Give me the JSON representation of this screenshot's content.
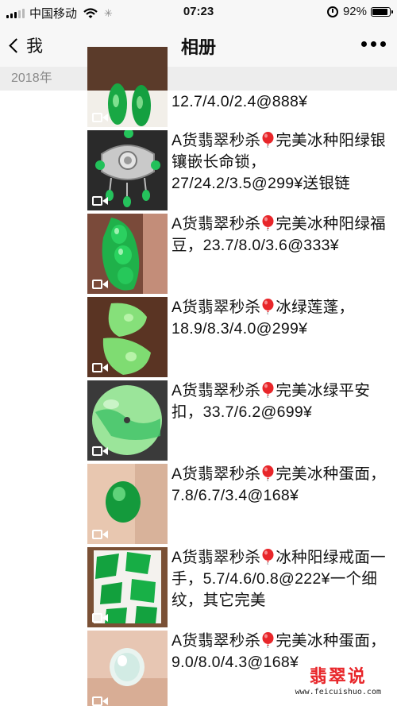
{
  "status_bar": {
    "carrier": "中国移动",
    "time": "07:23",
    "battery_text": "92%",
    "battery_level": 0.92
  },
  "nav": {
    "back_label": "我",
    "title": "相册",
    "more_icon": "more-dots-icon"
  },
  "section": {
    "year": "2018年"
  },
  "items": [
    {
      "prefix": "",
      "rest": "12.7/4.0/2.4@888¥"
    },
    {
      "prefix": "A货翡翠秒杀",
      "rest": "完美冰种阳绿银镶嵌长命锁，27/24.2/3.5@299¥送银链"
    },
    {
      "prefix": "A货翡翠秒杀",
      "rest": "完美冰种阳绿福豆，23.7/8.0/3.6@333¥"
    },
    {
      "prefix": "A货翡翠秒杀",
      "rest": "冰绿莲蓬，18.9/8.3/4.0@299¥"
    },
    {
      "prefix": "A货翡翠秒杀",
      "rest": "完美冰绿平安扣，33.7/6.2@699¥"
    },
    {
      "prefix": "A货翡翠秒杀",
      "rest": "完美冰种蛋面，7.8/6.7/3.4@168¥"
    },
    {
      "prefix": "A货翡翠秒杀",
      "rest": "冰种阳绿戒面一手，5.7/4.6/0.8@222¥一个细纹，其它完美"
    },
    {
      "prefix": "A货翡翠秒杀",
      "rest": "完美冰种蛋面，9.0/8.0/4.3@168¥"
    }
  ],
  "watermark": {
    "title": "翡翠说",
    "url": "www.feicuishuo.com"
  },
  "colors": {
    "jade_green": "#1fb14a",
    "balloon_red": "#e8262a",
    "section_bg": "#ededed"
  }
}
